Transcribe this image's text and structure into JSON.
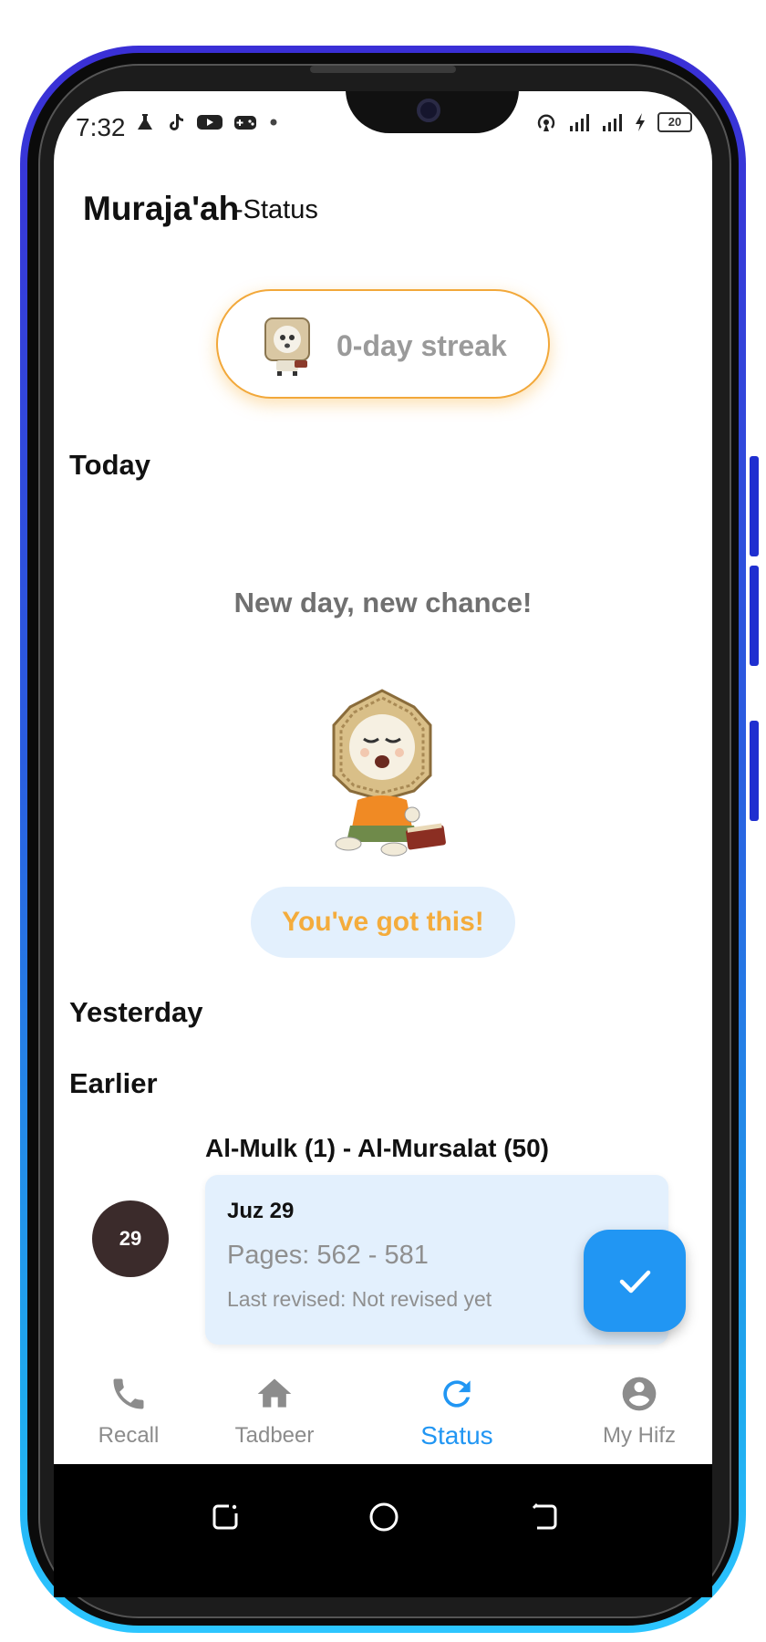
{
  "status_bar": {
    "time": "7:32",
    "left_icons": [
      "flask-icon",
      "tiktok-icon",
      "youtube-icon",
      "gamepad-icon",
      "dot-icon"
    ],
    "right_icons": [
      "hotspot-icon",
      "signal-icon",
      "signal-4g-icon",
      "charging-icon"
    ],
    "battery": "20"
  },
  "header": {
    "title": "Muraja'ah",
    "subtitle": "-Status"
  },
  "streak": {
    "label": "0-day streak"
  },
  "today": {
    "heading": "Today",
    "message": "New day, new chance!",
    "cheer_button": "You've got this!"
  },
  "yesterday": {
    "heading": "Yesterday"
  },
  "earlier": {
    "heading": "Earlier",
    "range_title": "Al-Mulk (1) - Al-Mursalat (50)",
    "juz_number": "29",
    "juz_name": "Juz 29",
    "pages": "Pages: 562 - 581",
    "last_revised": "Last revised: Not revised yet"
  },
  "bottom_nav": {
    "items": [
      {
        "label": "Recall",
        "icon": "phone-icon"
      },
      {
        "label": "Tadbeer",
        "icon": "home-icon"
      },
      {
        "label": "Status",
        "icon": "refresh-icon",
        "active": true
      },
      {
        "label": "My Hifz",
        "icon": "account-icon"
      }
    ]
  },
  "colors": {
    "accent": "#2196f3",
    "streak_border": "#f2a83a",
    "card_bg": "#e3f0fd",
    "cheer_text": "#f4ac3c",
    "juz_circle": "#3b2b2b"
  }
}
